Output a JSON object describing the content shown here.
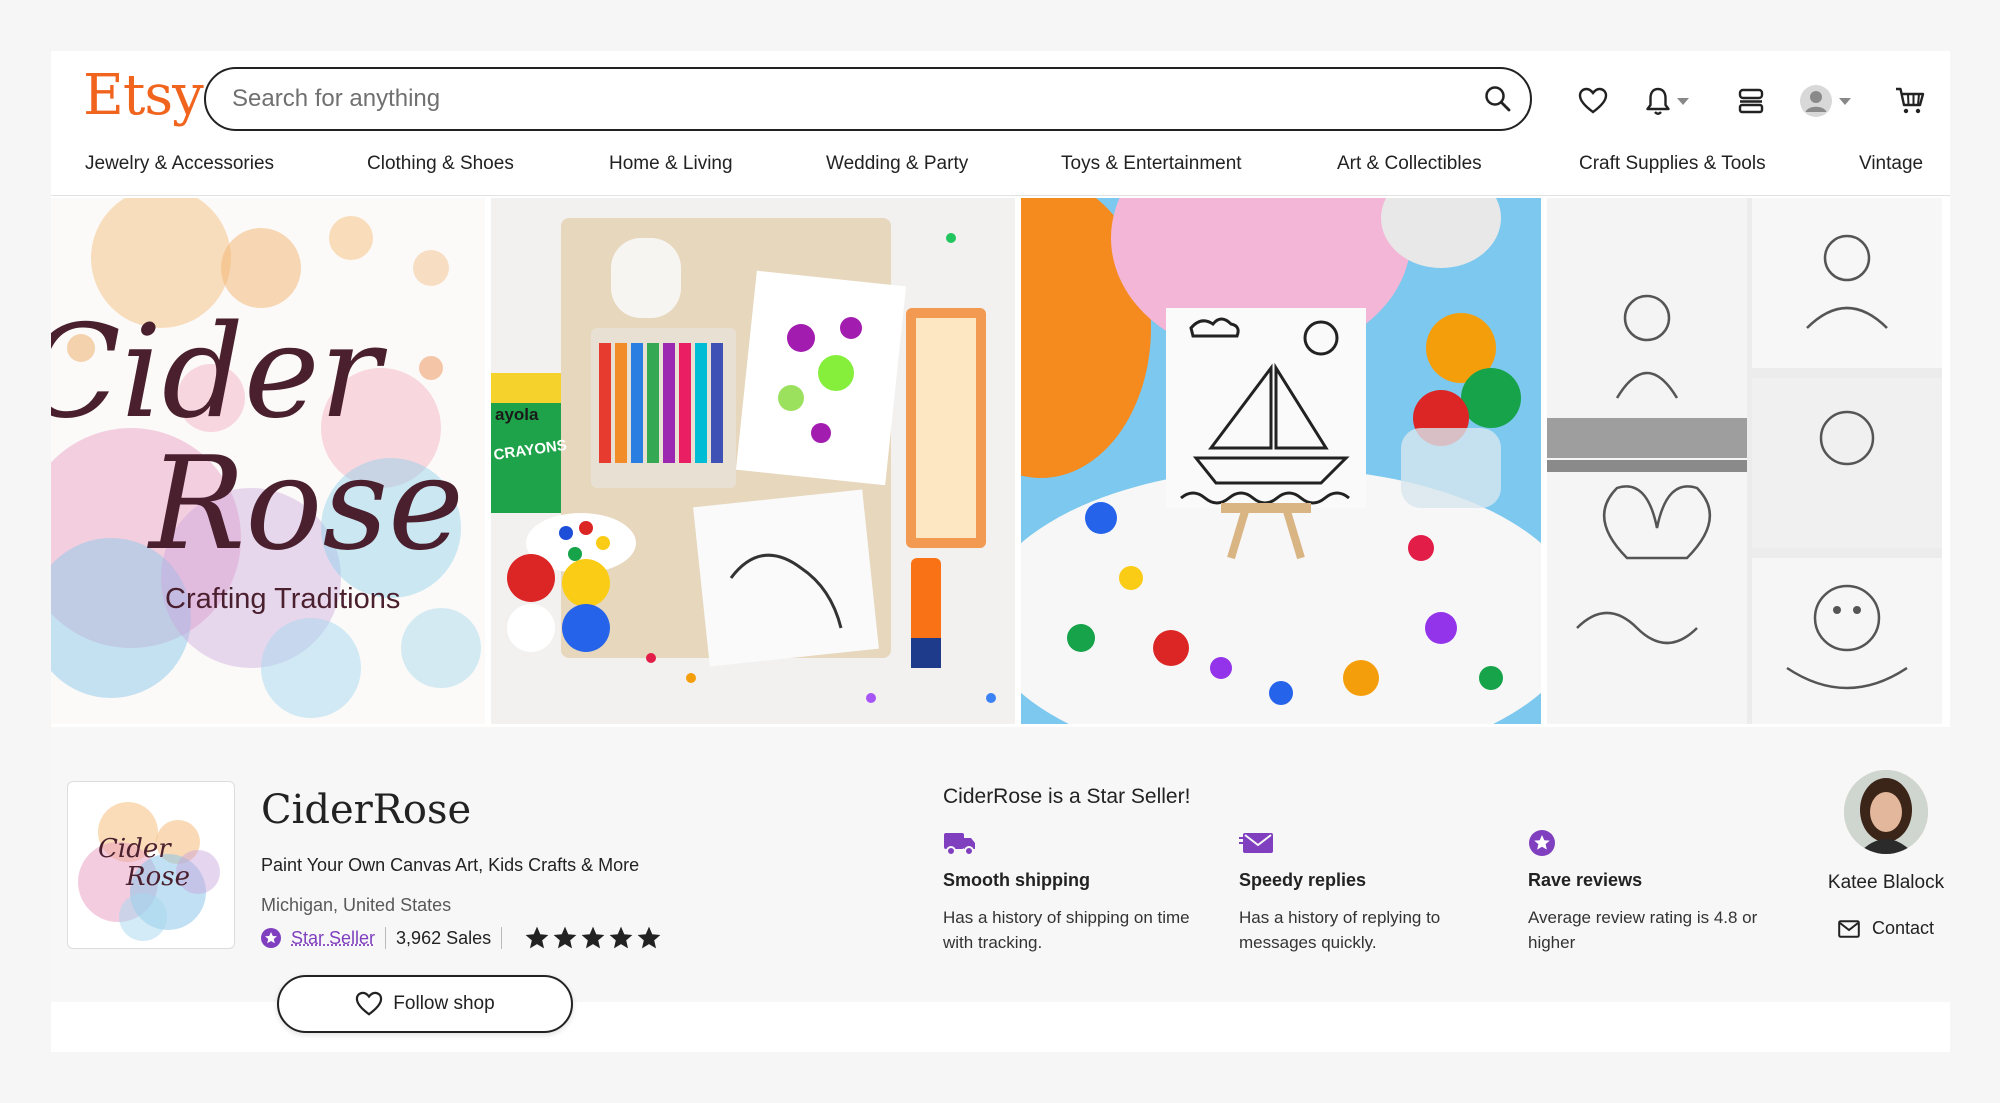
{
  "header": {
    "logo_text": "Etsy",
    "search_placeholder": "Search for anything",
    "icons": [
      "search-icon",
      "heart-icon",
      "bell-icon",
      "shop-icon",
      "user-avatar-icon",
      "cart-icon"
    ]
  },
  "nav": {
    "items": [
      {
        "label": "Jewelry & Accessories"
      },
      {
        "label": "Clothing & Shoes"
      },
      {
        "label": "Home & Living"
      },
      {
        "label": "Wedding & Party"
      },
      {
        "label": "Toys & Entertainment"
      },
      {
        "label": "Art & Collectibles"
      },
      {
        "label": "Craft Supplies & Tools"
      },
      {
        "label": "Vintage"
      }
    ]
  },
  "banner": {
    "logo_script_line1": "Cider",
    "logo_script_line2": "Rose",
    "logo_subtitle": "Crafting Traditions",
    "crayon_box_label_1": "ayola",
    "crayon_box_label_2": "CRAYONS"
  },
  "shop": {
    "logo_line1": "Cider",
    "logo_line2": "Rose",
    "name": "CiderRose",
    "tagline": "Paint Your Own Canvas Art, Kids Crafts & More",
    "location": "Michigan, United States",
    "star_seller_label": "Star Seller",
    "sales": "3,962 Sales",
    "rating_stars": 5,
    "follow_label": "Follow shop"
  },
  "star_seller": {
    "heading": "CiderRose is a Star Seller!",
    "perks": [
      {
        "icon": "truck-icon",
        "title": "Smooth shipping",
        "description": "Has a history of shipping on time with tracking."
      },
      {
        "icon": "message-icon",
        "title": "Speedy replies",
        "description": "Has a history of replying to messages quickly."
      },
      {
        "icon": "star-badge-icon",
        "title": "Rave reviews",
        "description": "Average review rating is 4.8 or higher"
      }
    ]
  },
  "owner": {
    "name": "Katee Blalock",
    "contact_label": "Contact"
  },
  "colors": {
    "brand_orange": "#f1641e",
    "star_seller_purple": "#7f3fbf",
    "text": "#222222"
  }
}
